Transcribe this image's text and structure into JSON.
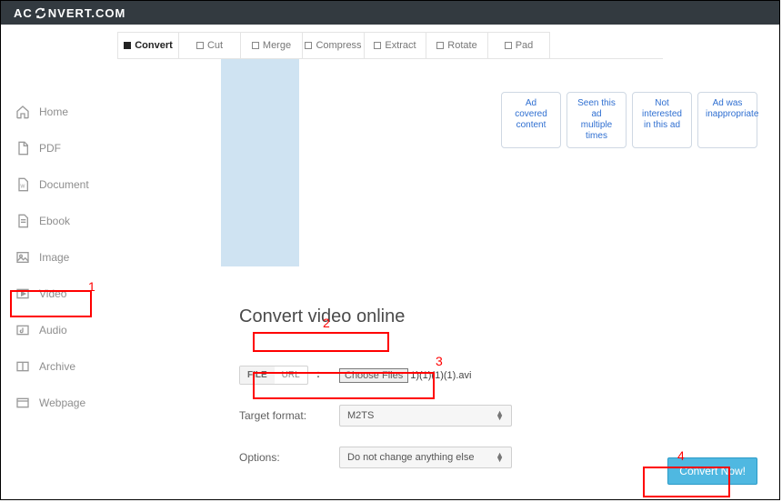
{
  "brand": {
    "prefix": "AC",
    "suffix": "NVERT.COM"
  },
  "sidebar": {
    "items": [
      {
        "label": "Home"
      },
      {
        "label": "PDF"
      },
      {
        "label": "Document"
      },
      {
        "label": "Ebook"
      },
      {
        "label": "Image"
      },
      {
        "label": "Video"
      },
      {
        "label": "Audio"
      },
      {
        "label": "Archive"
      },
      {
        "label": "Webpage"
      }
    ]
  },
  "tabs": [
    {
      "label": "Convert"
    },
    {
      "label": "Cut"
    },
    {
      "label": "Merge"
    },
    {
      "label": "Compress"
    },
    {
      "label": "Extract"
    },
    {
      "label": "Rotate"
    },
    {
      "label": "Pad"
    }
  ],
  "ad_feedback": [
    "Ad covered content",
    "Seen this ad multiple times",
    "Not interested in this ad",
    "Ad was inappropriate"
  ],
  "page": {
    "title": "Convert video online",
    "source_tabs": {
      "file": "FILE",
      "url": "URL"
    },
    "choose_btn": "Choose Files",
    "chosen_file": "1)(1)(1)(1).avi",
    "target_label": "Target format:",
    "target_value": "M2TS",
    "options_label": "Options:",
    "options_value": "Do not change anything else",
    "convert_btn": "Convert Now!"
  },
  "annotations": {
    "a1": "1",
    "a2": "2",
    "a3": "3",
    "a4": "4"
  }
}
